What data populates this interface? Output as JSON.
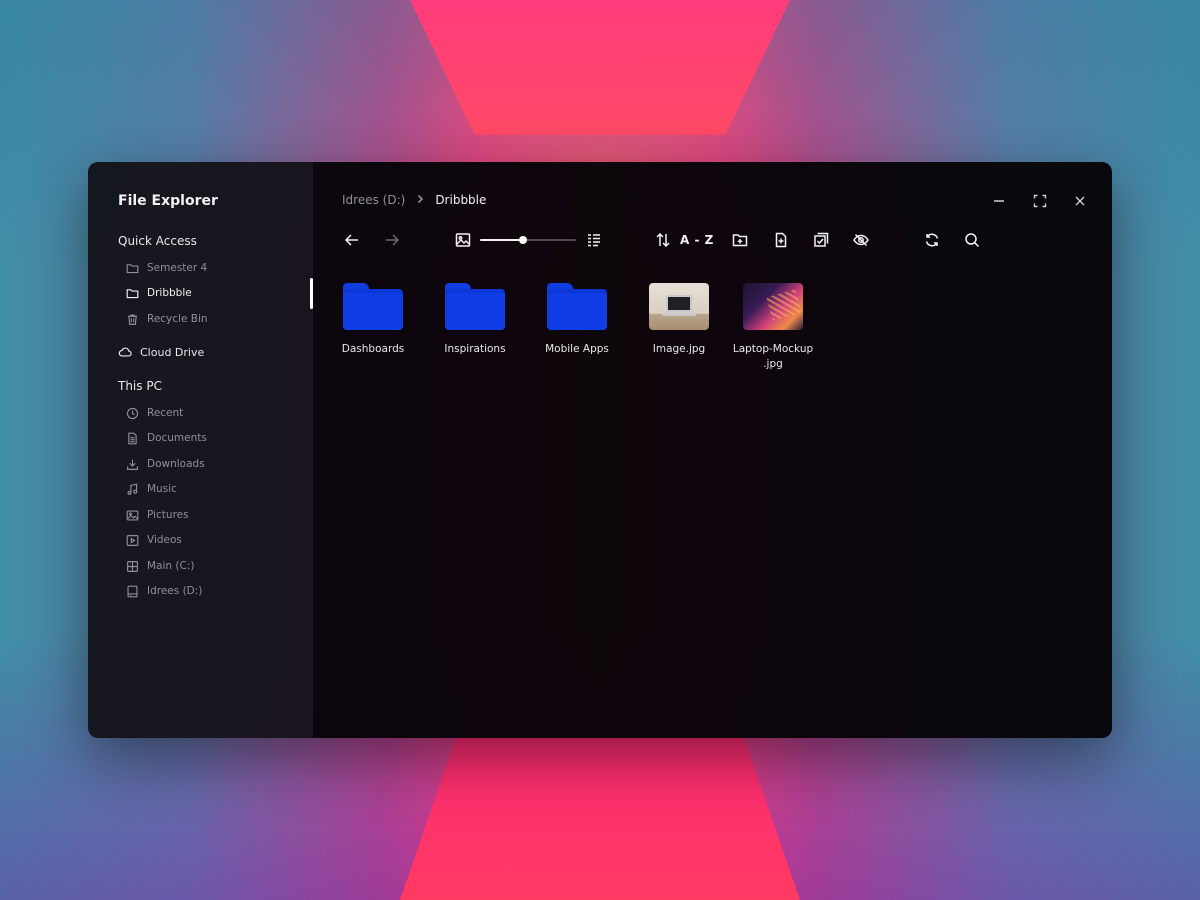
{
  "app": {
    "title": "File Explorer"
  },
  "sidebar": {
    "quick_access": {
      "title": "Quick Access",
      "items": [
        {
          "label": "Semester 4",
          "icon": "folder-icon",
          "active": false
        },
        {
          "label": "Dribbble",
          "icon": "folder-icon",
          "active": true
        },
        {
          "label": "Recycle Bin",
          "icon": "trash-icon",
          "active": false
        }
      ]
    },
    "cloud": {
      "label": "Cloud Drive",
      "icon": "cloud-icon"
    },
    "this_pc": {
      "title": "This PC",
      "items": [
        {
          "label": "Recent",
          "icon": "clock-icon"
        },
        {
          "label": "Documents",
          "icon": "document-icon"
        },
        {
          "label": "Downloads",
          "icon": "download-icon"
        },
        {
          "label": "Music",
          "icon": "music-icon"
        },
        {
          "label": "Pictures",
          "icon": "image-icon"
        },
        {
          "label": "Videos",
          "icon": "play-icon"
        },
        {
          "label": "Main (C:)",
          "icon": "windows-drive-icon"
        },
        {
          "label": "Idrees (D:)",
          "icon": "drive-icon"
        }
      ]
    }
  },
  "breadcrumb": {
    "parent": "Idrees (D:)",
    "current": "Dribbble"
  },
  "toolbar": {
    "sort_label": "A - Z",
    "zoom_level": 0.45
  },
  "files": [
    {
      "name": "Dashboards",
      "type": "folder"
    },
    {
      "name": "Inspirations",
      "type": "folder"
    },
    {
      "name": "Mobile Apps",
      "type": "folder"
    },
    {
      "name": "Image.jpg",
      "type": "image"
    },
    {
      "name": "Laptop-Mockup.jpg",
      "name_line1": "Laptop-Mockup",
      "name_line2": ".jpg",
      "type": "image"
    }
  ],
  "colors": {
    "accent": "#0f3ee6",
    "text_primary": "#f2f2f2",
    "text_secondary": "#8f8f96"
  }
}
